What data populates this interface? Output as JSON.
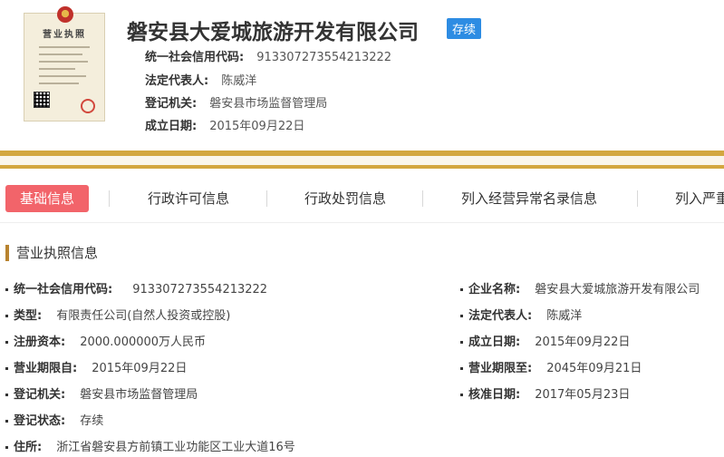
{
  "header": {
    "license_title": "营业执照",
    "company_name": "磐安县大爱城旅游开发有限公司",
    "status": "存续",
    "fields": [
      {
        "key": "统一社会信用代码:",
        "value": "913307273554213222"
      },
      {
        "key": "法定代表人:",
        "value": "陈威洋"
      },
      {
        "key": "登记机关:",
        "value": "磐安县市场监督管理局"
      },
      {
        "key": "成立日期:",
        "value": "2015年09月22日"
      }
    ]
  },
  "tabs": [
    {
      "label": "基础信息",
      "active": true
    },
    {
      "label": "行政许可信息",
      "active": false
    },
    {
      "label": "行政处罚信息",
      "active": false
    },
    {
      "label": "列入经营异常名录信息",
      "active": false
    },
    {
      "label": "列入严重",
      "active": false
    }
  ],
  "section": {
    "title": "营业执照信息"
  },
  "details_left": [
    {
      "key": "统一社会信用代码:",
      "value": "913307273554213222"
    },
    {
      "key": "类型:",
      "value": "有限责任公司(自然人投资或控股)"
    },
    {
      "key": "注册资本:",
      "value": "2000.000000万人民币"
    },
    {
      "key": "营业期限自:",
      "value": "2015年09月22日"
    },
    {
      "key": "登记机关:",
      "value": "磐安县市场监督管理局"
    },
    {
      "key": "登记状态:",
      "value": "存续"
    },
    {
      "key": "住所:",
      "value": "浙江省磐安县方前镇工业功能区工业大道16号"
    }
  ],
  "details_right": [
    {
      "key": "企业名称:",
      "value": "磐安县大爱城旅游开发有限公司"
    },
    {
      "key": "法定代表人:",
      "value": "陈威洋"
    },
    {
      "key": "成立日期:",
      "value": "2015年09月22日"
    },
    {
      "key": "营业期限至:",
      "value": "2045年09月21日"
    },
    {
      "key": "核准日期:",
      "value": "2017年05月23日"
    }
  ],
  "colors": {
    "accent": "#f2646a",
    "gold": "#d3a740",
    "status_tag": "#2d8ce3",
    "section_bar": "#b8832f"
  }
}
